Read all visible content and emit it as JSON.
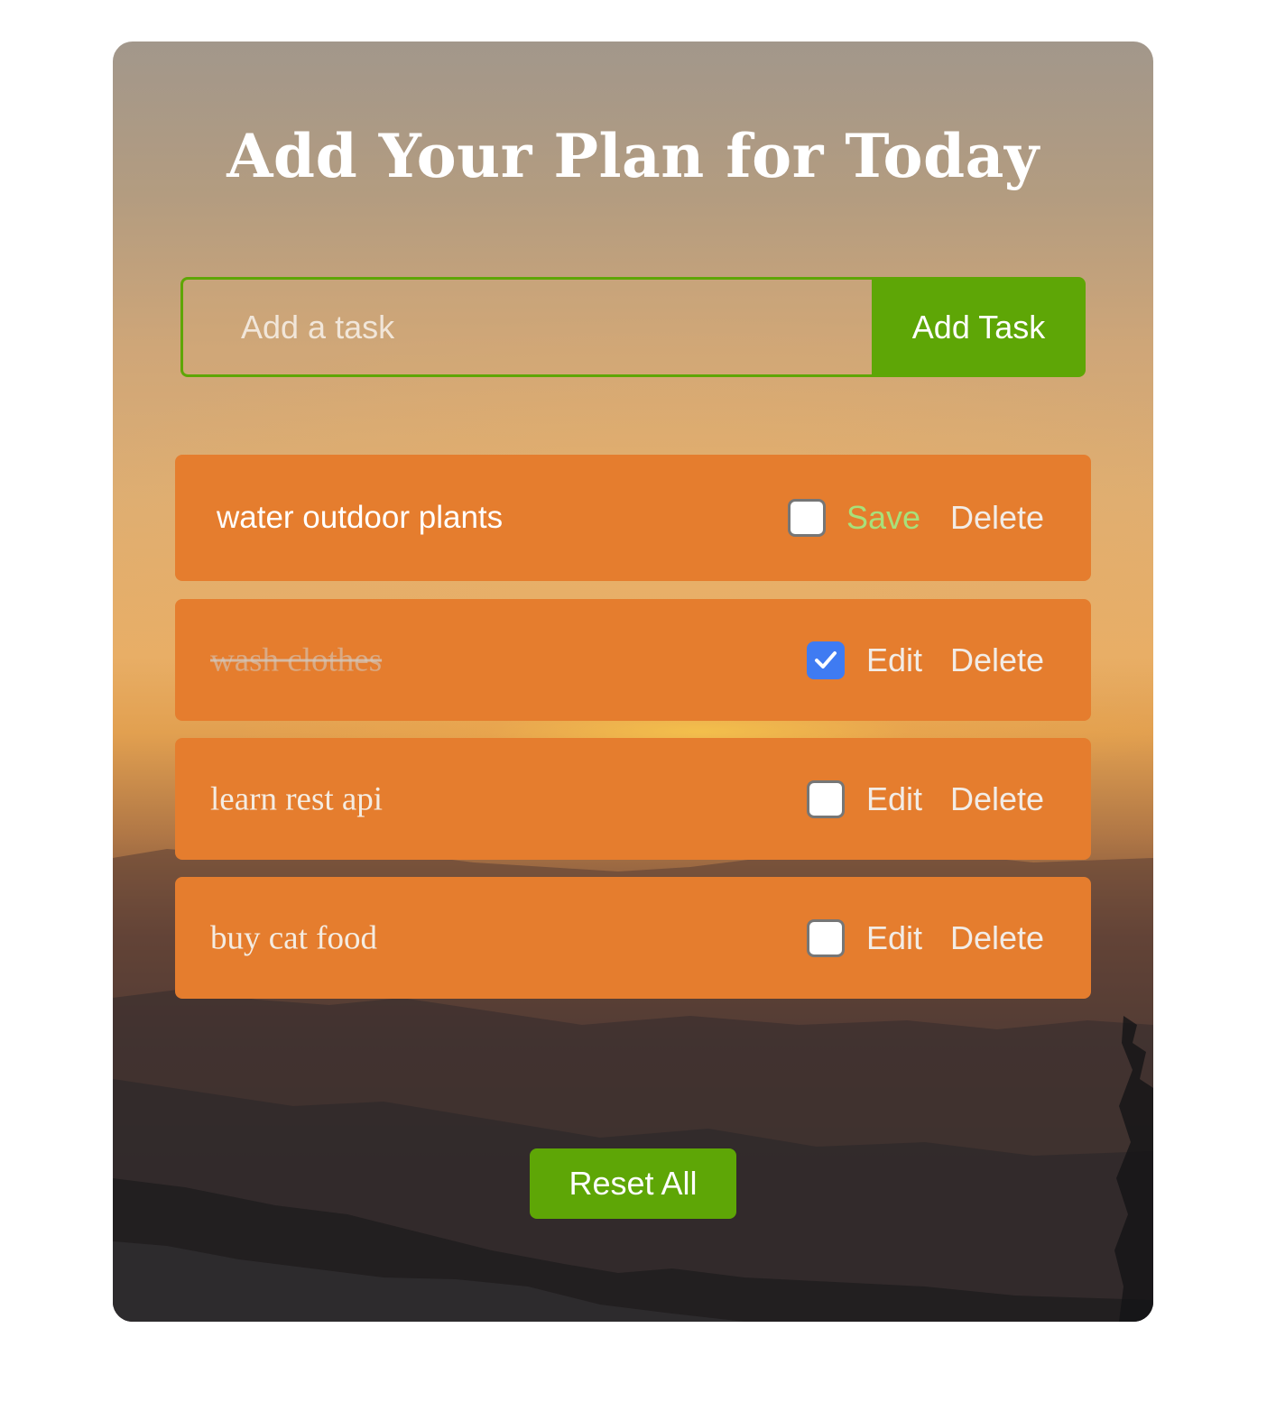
{
  "header": {
    "title": "Add Your Plan for Today"
  },
  "add_form": {
    "placeholder": "Add a task",
    "value": "",
    "button_label": "Add Task"
  },
  "tasks": [
    {
      "text": "water outdoor plants",
      "checked": false,
      "primary_action": "Save",
      "delete_label": "Delete"
    },
    {
      "text": "wash clothes",
      "checked": true,
      "primary_action": "Edit",
      "delete_label": "Delete"
    },
    {
      "text": "learn rest api",
      "checked": false,
      "primary_action": "Edit",
      "delete_label": "Delete"
    },
    {
      "text": "buy cat food",
      "checked": false,
      "primary_action": "Edit",
      "delete_label": "Delete"
    }
  ],
  "footer": {
    "reset_label": "Reset All"
  },
  "colors": {
    "accent_green": "#5ea606",
    "task_orange": "#e57d2e",
    "checkbox_blue": "#3f7bf2",
    "save_green": "#a8e07a"
  }
}
